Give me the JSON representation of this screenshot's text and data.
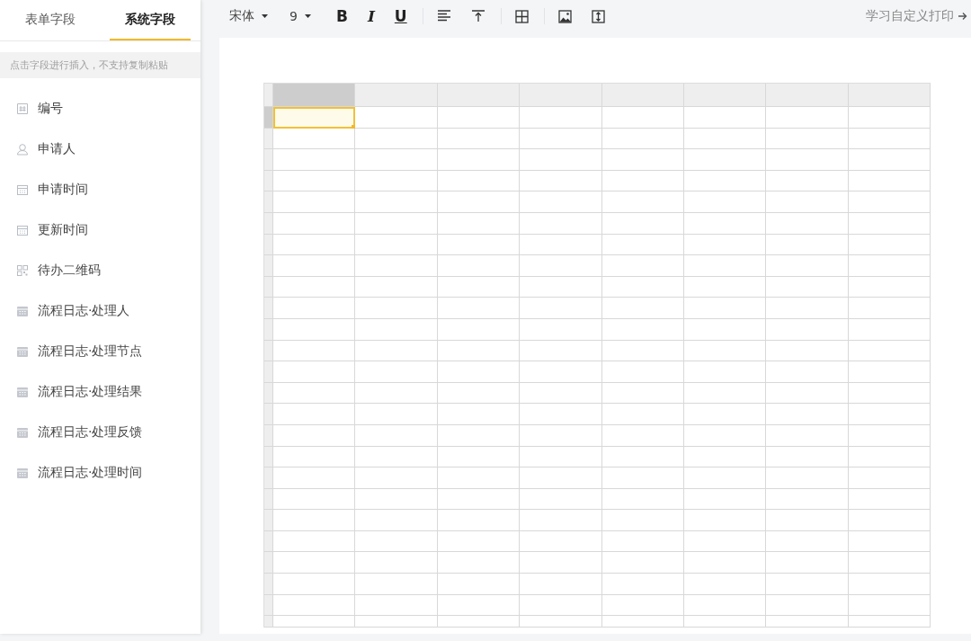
{
  "sidebar": {
    "tabs": [
      {
        "label": "表单字段",
        "selected": false
      },
      {
        "label": "系统字段",
        "selected": true
      }
    ],
    "hint": "点击字段进行插入，不支持复制粘贴",
    "items": [
      {
        "label": "编号",
        "kind": "number"
      },
      {
        "label": "申请人",
        "kind": "person"
      },
      {
        "label": "申请时间",
        "kind": "date"
      },
      {
        "label": "更新时间",
        "kind": "date"
      },
      {
        "label": "待办二维码",
        "kind": "qrcode"
      },
      {
        "label": "流程日志·处理人",
        "kind": "log"
      },
      {
        "label": "流程日志·处理节点",
        "kind": "log"
      },
      {
        "label": "流程日志·处理结果",
        "kind": "log"
      },
      {
        "label": "流程日志·处理反馈",
        "kind": "log"
      },
      {
        "label": "流程日志·处理时间",
        "kind": "log"
      }
    ]
  },
  "toolbar": {
    "dropdowns": [
      {
        "value": "宋体",
        "kind": "font"
      },
      {
        "value": "9",
        "kind": "size"
      }
    ],
    "groups": [
      {
        "buttons": [
          {
            "kind": "bold",
            "label": "B"
          },
          {
            "kind": "italic",
            "label": "I"
          },
          {
            "kind": "underline",
            "label": "U"
          }
        ]
      },
      {
        "buttons": [
          {
            "kind": "align-left"
          },
          {
            "kind": "align-top"
          }
        ]
      },
      {
        "buttons": [
          {
            "kind": "borders"
          }
        ]
      },
      {
        "buttons": [
          {
            "kind": "image"
          },
          {
            "kind": "row-height"
          }
        ]
      }
    ],
    "link": "学习自定义打印"
  },
  "sheet": {
    "columns": [
      {
        "selected": true
      },
      {
        "selected": false
      },
      {
        "selected": false
      },
      {
        "selected": false
      },
      {
        "selected": false
      },
      {
        "selected": false
      },
      {
        "selected": false
      },
      {
        "selected": false
      }
    ],
    "rows": [
      {
        "selected": true
      },
      {
        "selected": false
      },
      {
        "selected": false
      },
      {
        "selected": false
      },
      {
        "selected": false
      },
      {
        "selected": false
      },
      {
        "selected": false
      },
      {
        "selected": false
      },
      {
        "selected": false
      },
      {
        "selected": false
      },
      {
        "selected": false
      },
      {
        "selected": false
      },
      {
        "selected": false
      },
      {
        "selected": false
      },
      {
        "selected": false
      },
      {
        "selected": false
      },
      {
        "selected": false
      },
      {
        "selected": false
      },
      {
        "selected": false
      },
      {
        "selected": false
      },
      {
        "selected": false
      },
      {
        "selected": false
      },
      {
        "selected": false
      },
      {
        "selected": false
      },
      {
        "selected": false
      }
    ]
  }
}
